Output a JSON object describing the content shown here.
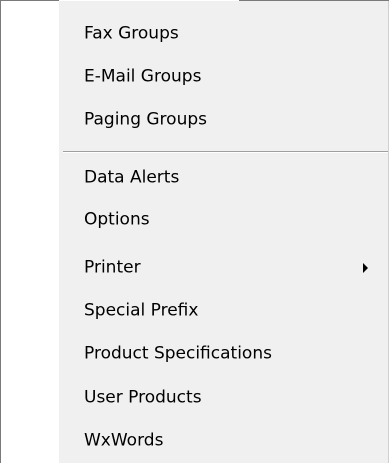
{
  "menu": {
    "group1": [
      {
        "label": "Fax Groups"
      },
      {
        "label": "E-Mail Groups"
      },
      {
        "label": "Paging Groups"
      }
    ],
    "group2": [
      {
        "label": "Data Alerts"
      },
      {
        "label": "Options"
      },
      {
        "label": "Printer",
        "has_submenu": true,
        "arrow_icon": "submenu-arrow-icon"
      },
      {
        "label": "Special Prefix"
      },
      {
        "label": "Product Specifications"
      },
      {
        "label": "User Products"
      },
      {
        "label": "WxWords"
      }
    ]
  },
  "colors": {
    "menu_background": "#f0f0f0",
    "gutter": "#ffffff",
    "separator": "#a0a0a0",
    "border": "#7a7a7a",
    "text": "#000000"
  }
}
